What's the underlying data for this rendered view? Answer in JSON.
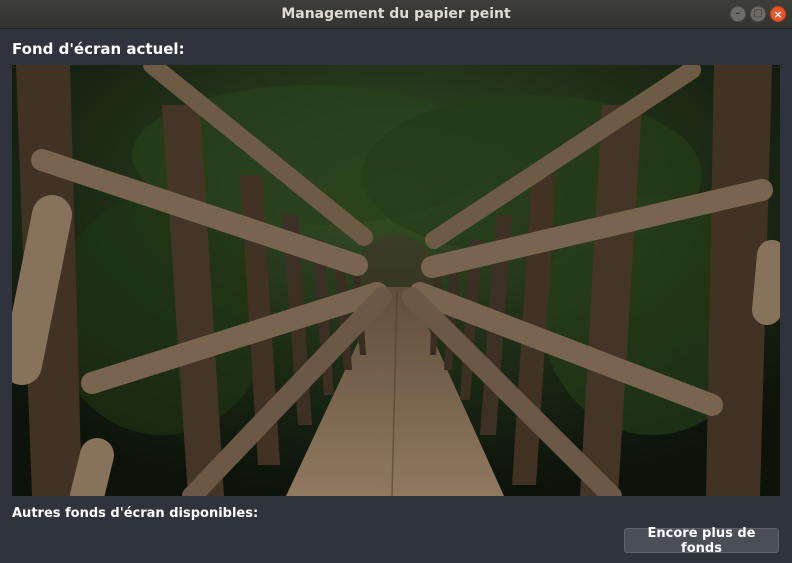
{
  "window": {
    "title": "Management du papier peint",
    "controls": {
      "minimize_icon": "minimize-icon",
      "maximize_icon": "maximize-icon",
      "close_icon": "close-icon"
    }
  },
  "current": {
    "heading": "Fond d'écran actuel:",
    "image": "forest-wooden-bridge"
  },
  "others": {
    "heading": "Autres fonds d'écran disponibles:"
  },
  "more_button": {
    "label": "Encore plus de fonds"
  },
  "colors": {
    "window_bg": "#2f333d",
    "titlebar": "#3c3b37",
    "close_button": "#e9542a",
    "button_bg": "#4a4e57"
  }
}
